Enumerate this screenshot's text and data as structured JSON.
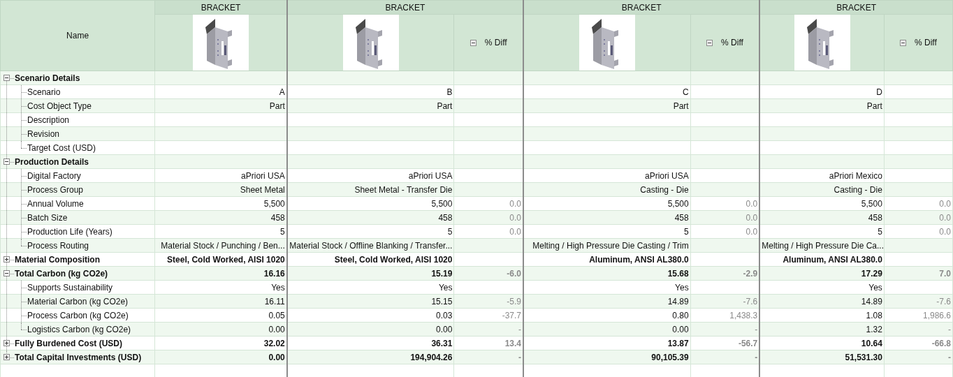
{
  "name_header": "Name",
  "scenarios": [
    {
      "title": "BRACKET"
    },
    {
      "title": "BRACKET",
      "diff_header": "% Diff",
      "diff_expanded": true
    },
    {
      "title": "BRACKET",
      "diff_header": "% Diff",
      "diff_expanded": true
    },
    {
      "title": "BRACKET",
      "diff_header": "% Diff",
      "diff_expanded": true
    }
  ],
  "rows": [
    {
      "label": "Scenario Details",
      "kind": "group",
      "expanded": true,
      "children": [
        {
          "label": "Scenario",
          "kind": "item",
          "cells": [
            {
              "value": "A"
            },
            {
              "value": "B"
            },
            {
              "value": "C"
            },
            {
              "value": "D"
            }
          ]
        },
        {
          "label": "Cost Object Type",
          "kind": "item",
          "cells": [
            {
              "value": "Part"
            },
            {
              "value": "Part"
            },
            {
              "value": "Part"
            },
            {
              "value": "Part"
            }
          ]
        },
        {
          "label": "Description",
          "kind": "item"
        },
        {
          "label": "Revision",
          "kind": "item"
        },
        {
          "label": "Target Cost (USD)",
          "kind": "item"
        }
      ]
    },
    {
      "label": "Production Details",
      "kind": "group",
      "expanded": true,
      "children": [
        {
          "label": "Digital Factory",
          "kind": "item",
          "cells": [
            {
              "value": "aPriori USA"
            },
            {
              "value": "aPriori USA"
            },
            {
              "value": "aPriori USA"
            },
            {
              "value": "aPriori Mexico"
            }
          ]
        },
        {
          "label": "Process Group",
          "kind": "item",
          "cells": [
            {
              "value": "Sheet Metal"
            },
            {
              "value": "Sheet Metal - Transfer Die"
            },
            {
              "value": "Casting - Die"
            },
            {
              "value": "Casting - Die"
            }
          ]
        },
        {
          "label": "Annual Volume",
          "kind": "item",
          "cells": [
            {
              "value": "5,500"
            },
            {
              "value": "5,500",
              "diff": "0.0"
            },
            {
              "value": "5,500",
              "diff": "0.0"
            },
            {
              "value": "5,500",
              "diff": "0.0"
            }
          ]
        },
        {
          "label": "Batch Size",
          "kind": "item",
          "cells": [
            {
              "value": "458"
            },
            {
              "value": "458",
              "diff": "0.0"
            },
            {
              "value": "458",
              "diff": "0.0"
            },
            {
              "value": "458",
              "diff": "0.0"
            }
          ]
        },
        {
          "label": "Production Life (Years)",
          "kind": "item",
          "cells": [
            {
              "value": "5"
            },
            {
              "value": "5",
              "diff": "0.0"
            },
            {
              "value": "5",
              "diff": "0.0"
            },
            {
              "value": "5",
              "diff": "0.0"
            }
          ]
        },
        {
          "label": "Process Routing",
          "kind": "item",
          "cells": [
            {
              "value": "Material Stock / Punching / Ben..."
            },
            {
              "value": "Material Stock / Offline Blanking / Transfer..."
            },
            {
              "value": "Melting / High Pressure Die Casting / Trim"
            },
            {
              "value": "Melting / High Pressure Die Ca..."
            }
          ]
        }
      ]
    },
    {
      "label": "Material Composition",
      "kind": "group",
      "expanded": false,
      "cells": [
        {
          "value": "Steel, Cold Worked, AISI 1020"
        },
        {
          "value": "Steel, Cold Worked, AISI 1020"
        },
        {
          "value": "Aluminum, ANSI AL380.0"
        },
        {
          "value": "Aluminum, ANSI AL380.0"
        }
      ]
    },
    {
      "label": "Total Carbon (kg CO2e)",
      "kind": "group",
      "expanded": true,
      "cells": [
        {
          "value": "16.16"
        },
        {
          "value": "15.19",
          "diff": "-6.0"
        },
        {
          "value": "15.68",
          "diff": "-2.9"
        },
        {
          "value": "17.29",
          "diff": "7.0"
        }
      ],
      "children": [
        {
          "label": "Supports Sustainability",
          "kind": "item",
          "cells": [
            {
              "value": "Yes"
            },
            {
              "value": "Yes"
            },
            {
              "value": "Yes"
            },
            {
              "value": "Yes"
            }
          ]
        },
        {
          "label": "Material Carbon (kg CO2e)",
          "kind": "item",
          "cells": [
            {
              "value": "16.11"
            },
            {
              "value": "15.15",
              "diff": "-5.9"
            },
            {
              "value": "14.89",
              "diff": "-7.6"
            },
            {
              "value": "14.89",
              "diff": "-7.6"
            }
          ]
        },
        {
          "label": "Process Carbon (kg CO2e)",
          "kind": "item",
          "cells": [
            {
              "value": "0.05"
            },
            {
              "value": "0.03",
              "diff": "-37.7"
            },
            {
              "value": "0.80",
              "diff": "1,438.3"
            },
            {
              "value": "1.08",
              "diff": "1,986.6"
            }
          ]
        },
        {
          "label": "Logistics Carbon (kg CO2e)",
          "kind": "item",
          "cells": [
            {
              "value": "0.00"
            },
            {
              "value": "0.00",
              "diff": "-"
            },
            {
              "value": "0.00",
              "diff": "-"
            },
            {
              "value": "1.32",
              "diff": "-"
            }
          ]
        }
      ]
    },
    {
      "label": "Fully Burdened Cost (USD)",
      "kind": "group",
      "expanded": false,
      "cells": [
        {
          "value": "32.02"
        },
        {
          "value": "36.31",
          "diff": "13.4"
        },
        {
          "value": "13.87",
          "diff": "-56.7"
        },
        {
          "value": "10.64",
          "diff": "-66.8"
        }
      ]
    },
    {
      "label": "Total Capital Investments (USD)",
      "kind": "group",
      "expanded": false,
      "cells": [
        {
          "value": "0.00"
        },
        {
          "value": "194,904.26",
          "diff": "-"
        },
        {
          "value": "90,105.39",
          "diff": "-"
        },
        {
          "value": "51,531.30",
          "diff": "-"
        }
      ]
    }
  ]
}
